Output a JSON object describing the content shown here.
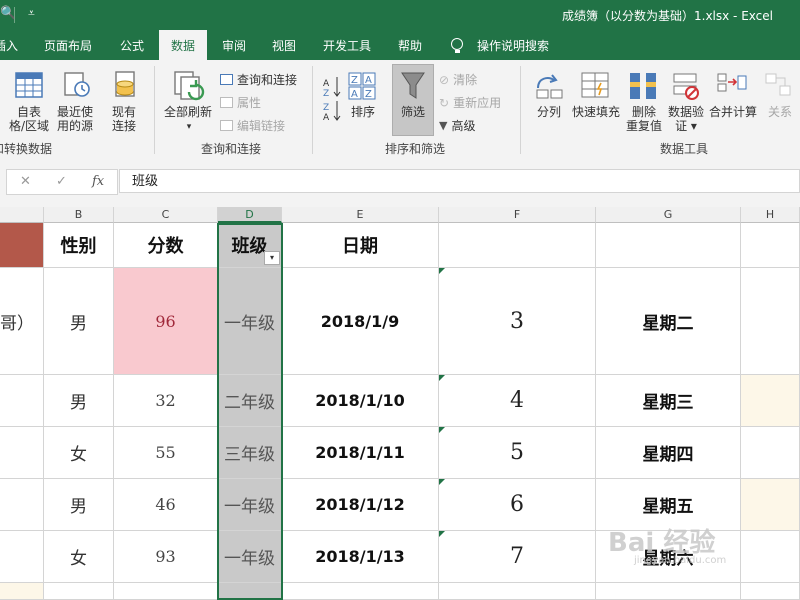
{
  "titlebar": {
    "qat_overflow": "⩡",
    "document_title": "成绩簿（以分数为基础）1.xlsx  -  Excel"
  },
  "tabs": [
    {
      "label": "插入"
    },
    {
      "label": "页面布局"
    },
    {
      "label": "公式"
    },
    {
      "label": "数据",
      "active": true
    },
    {
      "label": "审阅"
    },
    {
      "label": "视图"
    },
    {
      "label": "开发工具"
    },
    {
      "label": "帮助"
    },
    {
      "label": "操作说明搜索"
    }
  ],
  "ribbon": {
    "get_transform": {
      "group_label": "和转换数据",
      "from_table": "自表\n格/区域",
      "recent_sources": "最近使\n用的源",
      "existing_connections": "现有\n连接"
    },
    "queries": {
      "group_label": "查询和连接",
      "refresh_all": "全部刷新",
      "refresh_arrow": "▾",
      "queries_connections": "查询和连接",
      "properties": "属性",
      "edit_links": "编辑链接"
    },
    "sort_filter": {
      "group_label": "排序和筛选",
      "sort": "排序",
      "filter": "筛选",
      "clear": "清除",
      "reapply": "重新应用",
      "advanced": "高级"
    },
    "data_tools": {
      "group_label": "数据工具",
      "text_to_columns": "分列",
      "flash_fill": "快速填充",
      "remove_duplicates": "删除\n重复值",
      "data_validation": "数据验\n证 ▾",
      "consolidate": "合并计算",
      "relationships": "关系"
    }
  },
  "formula_bar": {
    "cancel": "✕",
    "enter": "✓",
    "fx": "fx",
    "value": "班级"
  },
  "sheet": {
    "columns": [
      "B",
      "C",
      "D",
      "E",
      "F",
      "G",
      "H"
    ],
    "headers": [
      "性别",
      "分数",
      "班级",
      "日期",
      "",
      "",
      ""
    ],
    "rows": [
      {
        "a": "哥）",
        "b": "男",
        "c": "96",
        "d": "一年级",
        "e": "2018/1/9",
        "f": "3",
        "g": "星期二"
      },
      {
        "a": "",
        "b": "男",
        "c": "32",
        "d": "二年级",
        "e": "2018/1/10",
        "f": "4",
        "g": "星期三"
      },
      {
        "a": "",
        "b": "女",
        "c": "55",
        "d": "三年级",
        "e": "2018/1/11",
        "f": "5",
        "g": "星期四"
      },
      {
        "a": "",
        "b": "男",
        "c": "46",
        "d": "一年级",
        "e": "2018/1/12",
        "f": "6",
        "g": "星期五"
      },
      {
        "a": "",
        "b": "女",
        "c": "93",
        "d": "一年级",
        "e": "2018/1/13",
        "f": "7",
        "g": "星期六"
      }
    ],
    "filter_dropdown": "▾"
  },
  "colors": {
    "excel_green": "#217346",
    "selected_column_fill": "#c9c9c9",
    "highlight_pink": "#f9c9cf",
    "header_brown": "#b3584a"
  },
  "watermark": {
    "text": "Bai 经验",
    "subtext": "jingyan.baidu.com"
  }
}
